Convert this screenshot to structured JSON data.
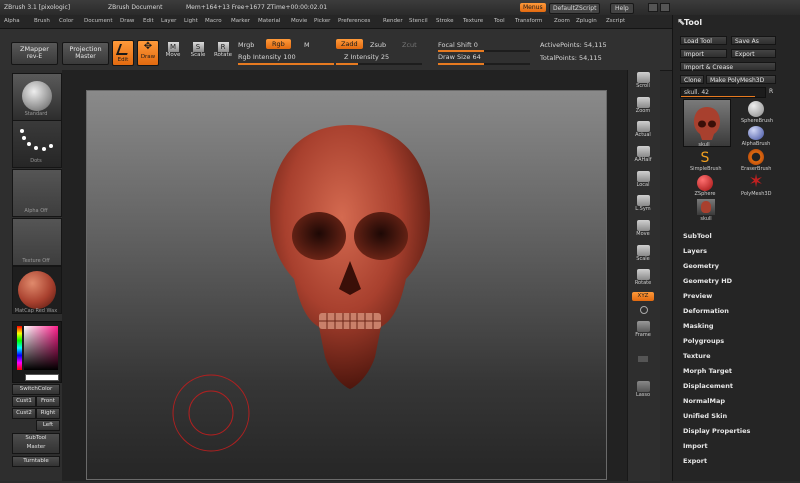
{
  "titlebar": {
    "app": "ZBrush  3.1 [pixologic]",
    "document": "ZBrush Document",
    "stats": "Mem+164+13 Free+1677 ZTime+00:00:02.01",
    "menus_btn": "Menus",
    "script": "DefaultZScript",
    "help": "Help"
  },
  "menubar": [
    "Alpha",
    "Brush",
    "Color",
    "Document",
    "Draw",
    "Edit",
    "Layer",
    "Light",
    "Macro",
    "Marker",
    "Material",
    "Movie",
    "Picker",
    "Preferences",
    "Render",
    "Stencil",
    "Stroke",
    "Texture",
    "Tool",
    "Transform",
    "Zoom",
    "Zplugin",
    "Zscript"
  ],
  "toolbar": {
    "zmapper": "ZMapper",
    "zmapper_sub": "rev-E",
    "projection": "Projection",
    "projection_sub": "Master",
    "edit": "Edit",
    "draw": "Draw",
    "move": "Move",
    "scale": "Scale",
    "rotate": "Rotate",
    "mrgb": "Mrgb",
    "rgb": "Rgb",
    "m": "M",
    "zadd": "Zadd",
    "zsub": "Zsub",
    "zcut": "Zcut",
    "rgb_intensity": "Rgb Intensity 100",
    "z_intensity": "Z Intensity 25",
    "focal_shift": "Focal Shift 0",
    "draw_size": "Draw Size 64",
    "active_points": "ActivePoints: 54,115",
    "total_points": "TotalPoints: 54,115"
  },
  "sliders": {
    "rgb_intensity": 1.0,
    "z_intensity": 0.25,
    "focal_shift": 0.5,
    "draw_size": 0.5
  },
  "leftpanel": {
    "standard": "Standard",
    "dots": "Dots",
    "alpha_off": "Alpha Off",
    "texture_off": "Texture Off",
    "matcap": "MatCap Red Wax",
    "switchcolor": "SwitchColor",
    "cust1": "Cust1",
    "front": "Front",
    "cust2": "Cust2",
    "right": "Right",
    "left": "Left",
    "subtool_master": "SubTool",
    "subtool_master_sub": "Master",
    "turntable": "Turntable"
  },
  "rightcol": [
    "Scroll",
    "Zoom",
    "Actual",
    "AAHalf",
    "Local",
    "L.Sym",
    "Move",
    "Scale",
    "Rotate",
    "XYZ",
    "Frame",
    "Lasso"
  ],
  "toolpanel": {
    "title": "Tool",
    "load_tool": "Load Tool",
    "save_as": "Save As",
    "import": "Import",
    "export": "Export",
    "import_crease": "Import & Crease",
    "clone": "Clone",
    "make_polymesh": "Make PolyMesh3D",
    "current_tool": "skull. 42",
    "r": "R",
    "brushes": [
      {
        "name": "skull",
        "icon": "skull-icon"
      },
      {
        "name": "SphereBrush",
        "icon": "sphere-brush-icon"
      },
      {
        "name": "AlphaBrush",
        "icon": "alpha-brush-icon"
      },
      {
        "name": "SimpleBrush",
        "icon": "simple-brush-icon"
      },
      {
        "name": "EraserBrush",
        "icon": "eraser-brush-icon"
      },
      {
        "name": "ZSphere",
        "icon": "zsphere-icon"
      },
      {
        "name": "PolyMesh3D",
        "icon": "polymesh3d-icon"
      },
      {
        "name": "skull",
        "icon": "skull-icon"
      }
    ],
    "sections": [
      "SubTool",
      "Layers",
      "Geometry",
      "Geometry HD",
      "Preview",
      "Deformation",
      "Masking",
      "Polygroups",
      "Texture",
      "Morph Target",
      "Displacement",
      "NormalMap",
      "Unified Skin",
      "Display Properties",
      "Import",
      "Export"
    ]
  },
  "colors": {
    "accent": "#e8761c",
    "material": "#a8402e",
    "brush_ring": "#b02020"
  }
}
